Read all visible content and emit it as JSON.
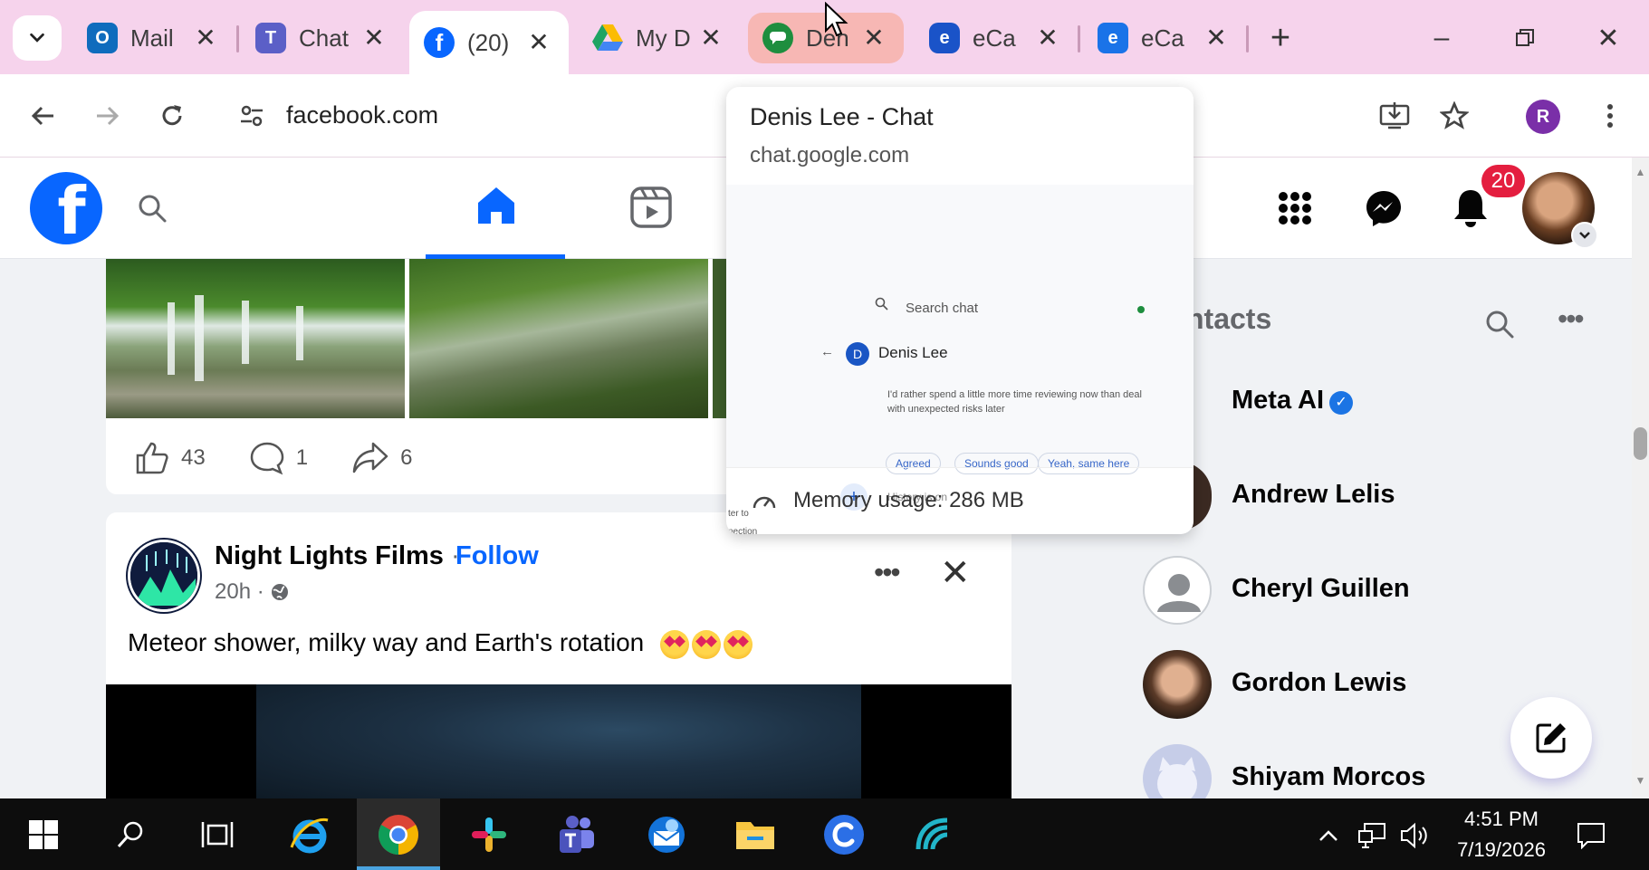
{
  "browser": {
    "tabs": [
      {
        "title": "Mail",
        "icon": "outlook-icon",
        "color": "#0f6cbd"
      },
      {
        "title": "Chat",
        "icon": "teams-icon",
        "color": "#5b5fc7"
      },
      {
        "title": "(20)",
        "icon": "facebook-icon",
        "color": "#0866ff",
        "active": true
      },
      {
        "title": "My D",
        "icon": "google-drive-icon",
        "color": "#1fa463"
      },
      {
        "title": "Den",
        "icon": "google-chat-icon",
        "color": "#1e8e3e",
        "highlighted": true
      },
      {
        "title": "eCa",
        "icon": "ecare-icon",
        "color": "#1a53c8"
      },
      {
        "title": "eCa",
        "icon": "ecare-icon",
        "color": "#1a73e8"
      }
    ],
    "url": "facebook.com",
    "profile_initial": "R"
  },
  "hover_card": {
    "title": "Denis Lee - Chat",
    "domain": "chat.google.com",
    "memory": "Memory usage: 286 MB",
    "preview": {
      "search_placeholder": "Search chat",
      "contact_name": "Denis Lee",
      "message_line1": "I'd rather spend a little more time reviewing now than deal",
      "message_line2": "with unexpected risks later",
      "replies": [
        "Agreed",
        "Sounds good",
        "Yeah, same here"
      ],
      "history": "History is on",
      "side_text_1": "ter to",
      "side_text_2": "nection"
    }
  },
  "facebook": {
    "notifications_count": "20",
    "first_post": {
      "likes": "43",
      "comments": "1",
      "shares": "6"
    },
    "second_post": {
      "page_name": "Night Lights Films",
      "separator": " · ",
      "follow": "Follow",
      "time": "20h ·",
      "text": "Meteor shower, milky way and Earth's rotation"
    },
    "contacts": {
      "title": "ntacts",
      "people": [
        {
          "name": "Meta AI",
          "verified": true
        },
        {
          "name": "Andrew Lelis"
        },
        {
          "name": "Cheryl Guillen"
        },
        {
          "name": "Gordon Lewis"
        },
        {
          "name": "Shiyam Morcos"
        }
      ]
    }
  },
  "taskbar": {
    "time": "4:51 PM",
    "date": "7/19/2026"
  }
}
